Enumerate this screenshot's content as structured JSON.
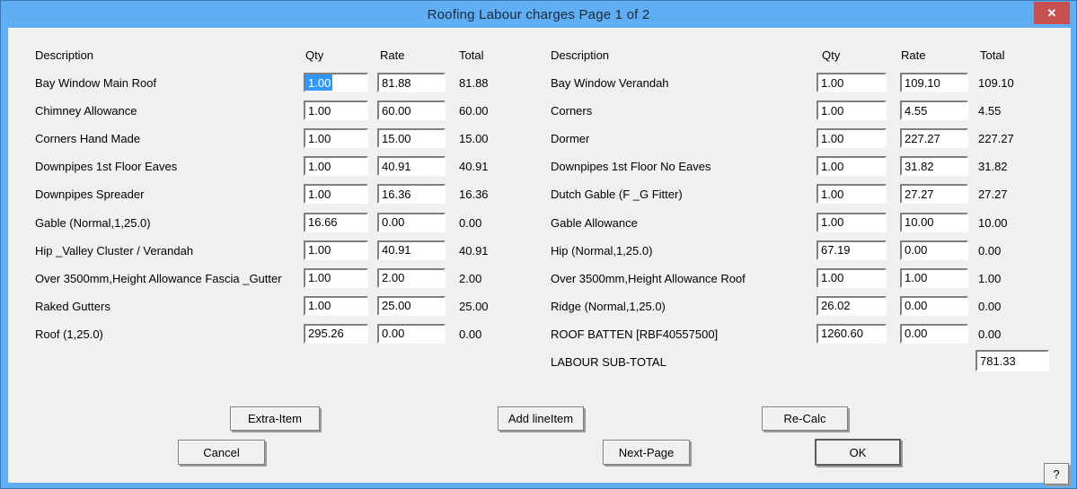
{
  "window": {
    "title": "Roofing Labour charges Page 1 of 2",
    "close_glyph": "✕"
  },
  "colors": {
    "titlebar_blue": "#5fadf2",
    "frame_border_blue": "#3a76b0",
    "close_red": "#c75050",
    "content_bg": "#f0f0f0",
    "selection_blue": "#3398fd"
  },
  "table": {
    "headers": {
      "description": "Description",
      "qty": "Qty",
      "rate": "Rate",
      "total": "Total"
    }
  },
  "left_rows": [
    {
      "desc": "Bay Window Main Roof",
      "qty": "1.00",
      "rate": "81.88",
      "total": "81.88",
      "selected": true
    },
    {
      "desc": "Chimney Allowance",
      "qty": "1.00",
      "rate": "60.00",
      "total": "60.00"
    },
    {
      "desc": "Corners Hand Made",
      "qty": "1.00",
      "rate": "15.00",
      "total": "15.00"
    },
    {
      "desc": "Downpipes 1st Floor Eaves",
      "qty": "1.00",
      "rate": "40.91",
      "total": "40.91"
    },
    {
      "desc": "Downpipes Spreader",
      "qty": "1.00",
      "rate": "16.36",
      "total": "16.36"
    },
    {
      "desc": "Gable (Normal,1,25.0)",
      "qty": "16.66",
      "rate": "0.00",
      "total": "0.00"
    },
    {
      "desc": "Hip _Valley Cluster / Verandah",
      "qty": "1.00",
      "rate": "40.91",
      "total": "40.91"
    },
    {
      "desc": "Over 3500mm,Height Allowance Fascia _Gutter",
      "qty": "1.00",
      "rate": "2.00",
      "total": "2.00"
    },
    {
      "desc": "Raked Gutters",
      "qty": "1.00",
      "rate": "25.00",
      "total": "25.00"
    },
    {
      "desc": "Roof (1,25.0)",
      "qty": "295.26",
      "rate": "0.00",
      "total": "0.00"
    }
  ],
  "right_rows": [
    {
      "desc": "Bay Window Verandah",
      "qty": "1.00",
      "rate": "109.10",
      "total": "109.10"
    },
    {
      "desc": "Corners",
      "qty": "1.00",
      "rate": "4.55",
      "total": "4.55"
    },
    {
      "desc": "Dormer",
      "qty": "1.00",
      "rate": "227.27",
      "total": "227.27"
    },
    {
      "desc": "Downpipes 1st Floor No Eaves",
      "qty": "1.00",
      "rate": "31.82",
      "total": "31.82"
    },
    {
      "desc": "Dutch Gable (F _G Fitter)",
      "qty": "1.00",
      "rate": "27.27",
      "total": "27.27"
    },
    {
      "desc": "Gable Allowance",
      "qty": "1.00",
      "rate": "10.00",
      "total": "10.00"
    },
    {
      "desc": "Hip (Normal,1,25.0)",
      "qty": "67.19",
      "rate": "0.00",
      "total": "0.00"
    },
    {
      "desc": "Over 3500mm,Height Allowance Roof",
      "qty": "1.00",
      "rate": "1.00",
      "total": "1.00"
    },
    {
      "desc": "Ridge (Normal,1,25.0)",
      "qty": "26.02",
      "rate": "0.00",
      "total": "0.00"
    },
    {
      "desc": "ROOF BATTEN [RBF40557500]",
      "qty": "1260.60",
      "rate": "0.00",
      "total": "0.00"
    }
  ],
  "subtotal": {
    "label": "LABOUR SUB-TOTAL",
    "value": "781.33"
  },
  "buttons": {
    "extra_item": "Extra-Item",
    "cancel": "Cancel",
    "add_lineitem": "Add lineItem",
    "next_page": "Next-Page",
    "recalc": "Re-Calc",
    "ok": "OK",
    "help": "?"
  }
}
